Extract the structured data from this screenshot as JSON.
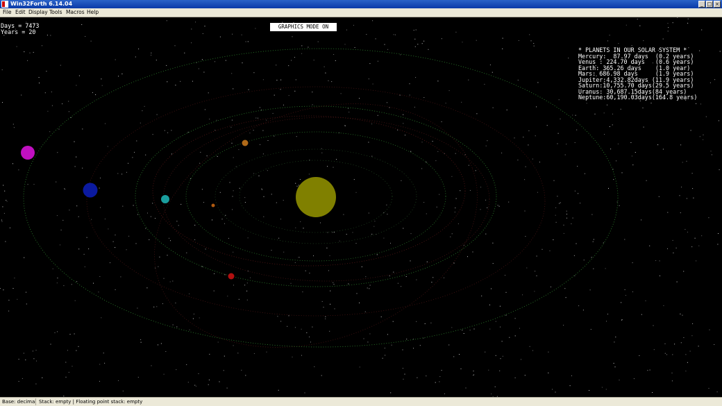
{
  "window": {
    "title": "Win32Forth 6.14.04"
  },
  "menu": [
    "File",
    "Edit",
    "Display",
    "Tools",
    "Macros",
    "Help"
  ],
  "counters": {
    "days": "Days = 7473",
    "years": "Years = 20"
  },
  "banner": "GRAPHICS MODE ON",
  "legend": {
    "heading": "* PLANETS IN OUR SOLAR SYSTEM *",
    "rows": [
      "Mercury:  87.97 days  (0.2 years)",
      "Venus : 224.70 days   (0.6 years)",
      "Earth: 365.26 days    (1.0 year)",
      "Mars: 686.98 days     (1.9 years)",
      "Jupiter:4,332.82days (11.9 years)",
      "Saturn:10,755.70 days(29.5 years)",
      "Uranus: 30,687.15days(84 years)",
      "Neptune:60,190.03days(164.8 years)"
    ]
  },
  "colors": {
    "sun": "#808000",
    "mercury": "#b05a10",
    "venus": "#b06a18",
    "earth": "#1a9e9e",
    "mars": "#b01010",
    "jupiter": "#0b1aa0",
    "saturn": "#c010c0",
    "orbit_green": "#2a7a2a",
    "orbit_red": "#5a1818"
  },
  "statusbar": {
    "base": "Base: decimal",
    "stack": "Stack: empty | Floating point stack: empty"
  }
}
